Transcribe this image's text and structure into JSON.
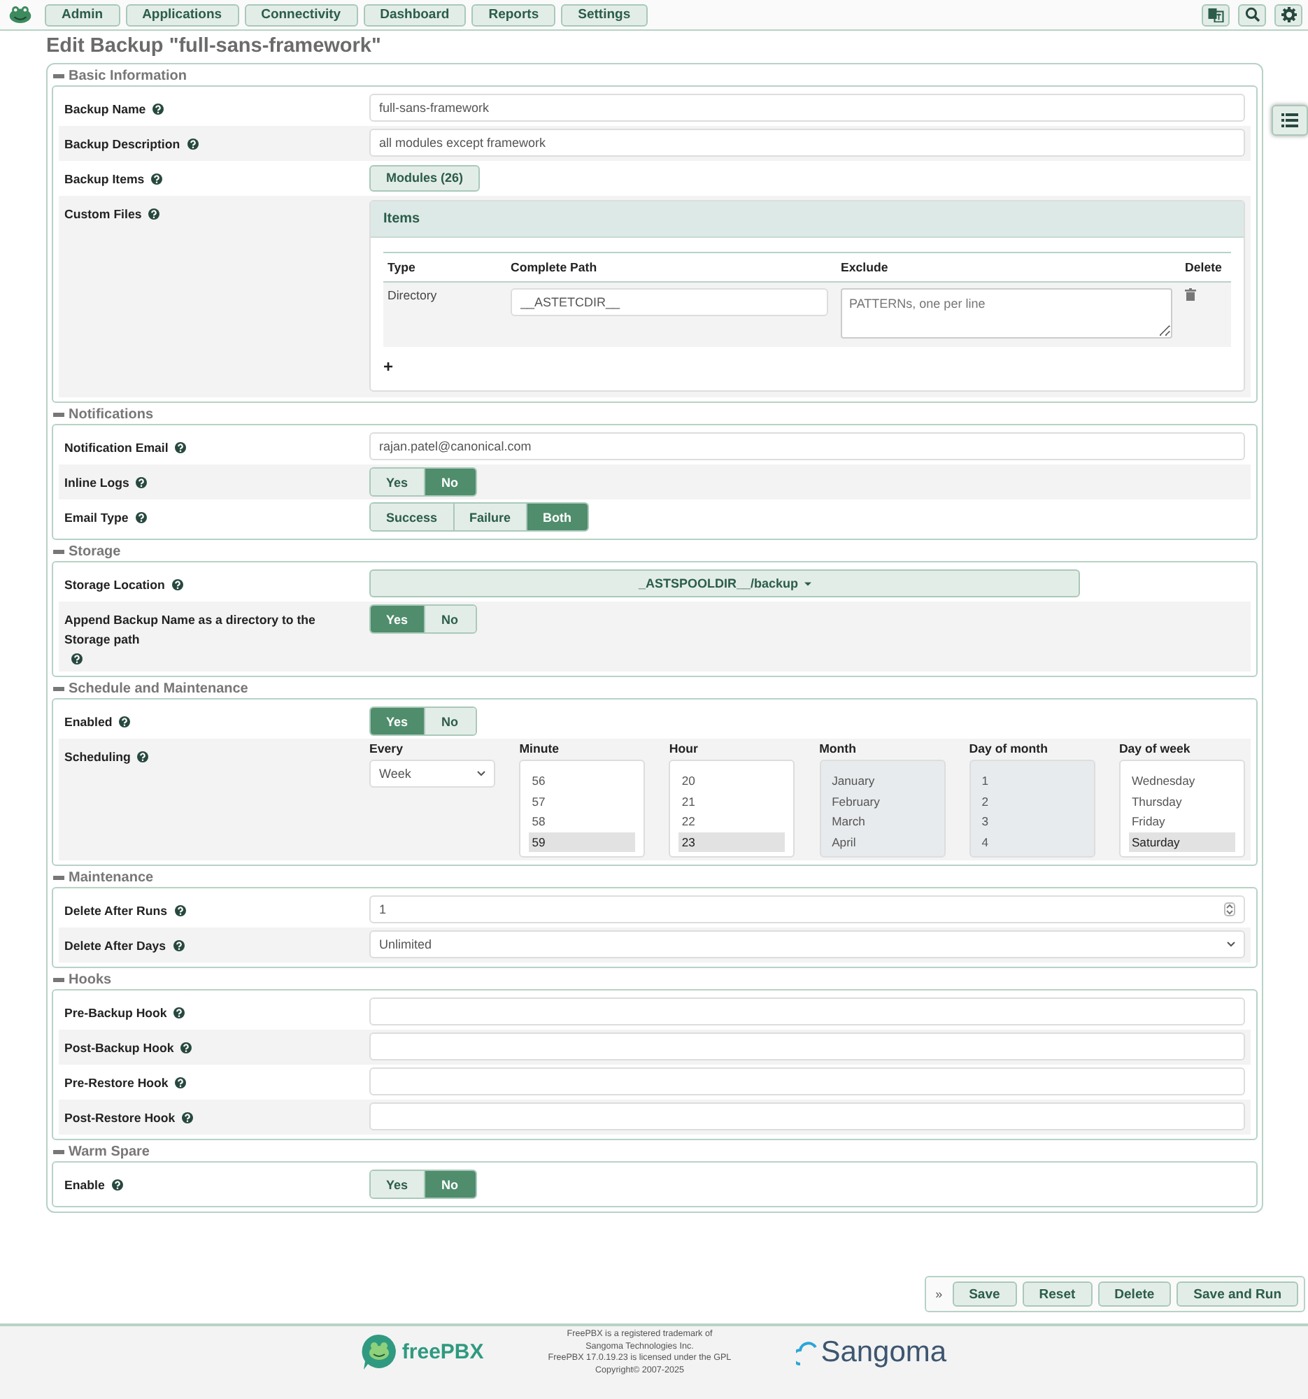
{
  "nav": {
    "tabs": [
      "Admin",
      "Applications",
      "Connectivity",
      "Dashboard",
      "Reports",
      "Settings"
    ]
  },
  "page_title": "Edit Backup \"full-sans-framework\"",
  "sections": [
    {
      "title": "Basic Information",
      "rows": [
        {
          "kind": "text",
          "label": "Backup Name",
          "value": "full-sans-framework"
        },
        {
          "kind": "text",
          "label": "Backup Description",
          "value": "all modules except framework"
        },
        {
          "kind": "button",
          "label": "Backup Items",
          "button": "Modules (26)"
        },
        {
          "kind": "items",
          "label": "Custom Files",
          "title": "Items",
          "columns": [
            "Type",
            "Complete Path",
            "Exclude",
            "Delete"
          ],
          "rows": [
            {
              "type": "Directory",
              "path": "__ASTETCDIR__",
              "exclude_placeholder": "PATTERNs, one per line"
            }
          ],
          "add": "+"
        }
      ]
    },
    {
      "title": "Notifications",
      "rows": [
        {
          "kind": "text",
          "label": "Notification Email",
          "value": "rajan.patel@canonical.com"
        },
        {
          "kind": "toggle",
          "label": "Inline Logs",
          "options": [
            {
              "label": "Yes",
              "selected": false
            },
            {
              "label": "No",
              "selected": true
            }
          ]
        },
        {
          "kind": "toggle",
          "label": "Email Type",
          "options": [
            {
              "label": "Success",
              "selected": false
            },
            {
              "label": "Failure",
              "selected": false
            },
            {
              "label": "Both",
              "selected": true
            }
          ]
        }
      ]
    },
    {
      "title": "Storage",
      "rows": [
        {
          "kind": "dropdown",
          "label": "Storage Location",
          "value": "_ASTSPOOLDIR__/backup"
        },
        {
          "kind": "toggle",
          "label": "Append Backup Name as a directory to the Storage path",
          "options": [
            {
              "label": "Yes",
              "selected": true
            },
            {
              "label": "No",
              "selected": false
            }
          ]
        }
      ]
    },
    {
      "title": "Schedule and Maintenance",
      "rows": [
        {
          "kind": "toggle",
          "label": "Enabled",
          "options": [
            {
              "label": "Yes",
              "selected": true
            },
            {
              "label": "No",
              "selected": false
            }
          ]
        },
        {
          "kind": "schedule",
          "label": "Scheduling",
          "every_heading": "Every",
          "every_value": "Week",
          "lists": [
            {
              "heading": "Minute",
              "disabled": false,
              "items": [
                {
                  "label": "56",
                  "selected": false
                },
                {
                  "label": "57",
                  "selected": false
                },
                {
                  "label": "58",
                  "selected": false
                },
                {
                  "label": "59",
                  "selected": true
                }
              ]
            },
            {
              "heading": "Hour",
              "disabled": false,
              "items": [
                {
                  "label": "20",
                  "selected": false
                },
                {
                  "label": "21",
                  "selected": false
                },
                {
                  "label": "22",
                  "selected": false
                },
                {
                  "label": "23",
                  "selected": true
                }
              ]
            },
            {
              "heading": "Month",
              "disabled": true,
              "items": [
                {
                  "label": "January",
                  "selected": false
                },
                {
                  "label": "February",
                  "selected": false
                },
                {
                  "label": "March",
                  "selected": false
                },
                {
                  "label": "April",
                  "selected": false
                }
              ]
            },
            {
              "heading": "Day of month",
              "disabled": true,
              "items": [
                {
                  "label": "1",
                  "selected": false
                },
                {
                  "label": "2",
                  "selected": false
                },
                {
                  "label": "3",
                  "selected": false
                },
                {
                  "label": "4",
                  "selected": false
                }
              ]
            },
            {
              "heading": "Day of week",
              "disabled": false,
              "items": [
                {
                  "label": "Wednesday",
                  "selected": false
                },
                {
                  "label": "Thursday",
                  "selected": false
                },
                {
                  "label": "Friday",
                  "selected": false
                },
                {
                  "label": "Saturday",
                  "selected": true
                }
              ]
            }
          ]
        }
      ]
    },
    {
      "title": "Maintenance",
      "rows": [
        {
          "kind": "number",
          "label": "Delete After Runs",
          "value": "1"
        },
        {
          "kind": "select",
          "label": "Delete After Days",
          "value": "Unlimited"
        }
      ]
    },
    {
      "title": "Hooks",
      "rows": [
        {
          "kind": "text",
          "label": "Pre-Backup Hook"
        },
        {
          "kind": "text",
          "label": "Post-Backup Hook"
        },
        {
          "kind": "text",
          "label": "Pre-Restore Hook"
        },
        {
          "kind": "text",
          "label": "Post-Restore Hook"
        }
      ]
    },
    {
      "title": "Warm Spare",
      "rows": [
        {
          "kind": "toggle",
          "label": "Enable",
          "options": [
            {
              "label": "Yes",
              "selected": false
            },
            {
              "label": "No",
              "selected": true
            }
          ]
        }
      ]
    }
  ],
  "actions": {
    "expander": "»",
    "buttons": [
      "Save",
      "Reset",
      "Delete",
      "Save and Run"
    ]
  },
  "footer": {
    "brand": "freePBX",
    "lines": [
      "FreePBX is a registered trademark of",
      "Sangoma Technologies Inc.",
      "FreePBX 17.0.19.23 is licensed under the GPL",
      "Copyright© 2007-2025"
    ],
    "partner": "Sangoma"
  }
}
